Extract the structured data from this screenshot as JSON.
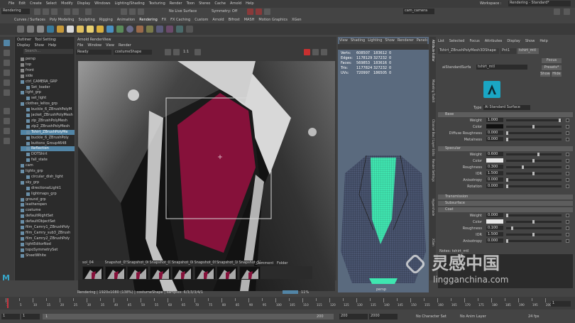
{
  "menubar": {
    "items": [
      "File",
      "Edit",
      "Create",
      "Select",
      "Modify",
      "Display",
      "Windows",
      "Lighting/Shading",
      "Texturing",
      "Render",
      "Toon",
      "Stereo",
      "Cache",
      "Arnold",
      "Help"
    ],
    "mode": "Rendering",
    "no_live": "No Live Surface",
    "symmetry": "Symmetry: Off",
    "camera": "cam_camera",
    "workspace_label": "Workspace :",
    "workspace": "Rendering - Standard*"
  },
  "shelf": {
    "tabs": [
      "Curves / Surfaces",
      "Poly Modeling",
      "Sculpting",
      "Rigging",
      "Animation",
      "Rendering",
      "FX",
      "FX Caching",
      "Custom",
      "Arnold",
      "Bifrost",
      "MASH",
      "Motion Graphics",
      "XGen"
    ]
  },
  "outliner": {
    "tabs": [
      "Outliner",
      "Tool Settings"
    ],
    "menu": [
      "Display",
      "Show",
      "Help"
    ],
    "search": "Search...",
    "rows": [
      "persp",
      "top",
      "front",
      "side",
      "ctrl_CAMERA_GRP",
      "Set_loader",
      "light_grp",
      "set_light",
      "clothes_leltos_grp",
      "buckle_6_ZBrushPolyM",
      "jacket_ZBrushPolyMesh",
      "zip_ZBrushPolyMesh",
      "zip2_ZBrushPolyMesh",
      "Tshirt_ZBrushPolyMe",
      "buckle_6_ZBrushPoly",
      "buttons_Group4648",
      "Reflection",
      "DOTShirt",
      "fall_state",
      "cam",
      "lights_grp",
      "circular_dish_light",
      "sky_grp",
      "directionalLight1",
      "lightmaps_grp",
      "ground_grp",
      "leatheropen",
      "costume",
      "defaultRightSet",
      "defaultObjectSet",
      "film_Camry1_ZBrushPoly",
      "film_Camry_sub3_ZBrush",
      "film_Camry2_ZBrushPoly",
      "lightEditorNod",
      "topoSymmetrySet",
      "SheetWhite"
    ]
  },
  "renderview": {
    "title": "Arnold RenderView",
    "menu": [
      "File",
      "Window",
      "View",
      "Render"
    ],
    "status": "Ready",
    "camera": "costumeShape",
    "ratio": "1:1",
    "snapshots": [
      "sol_04",
      "Snapshot_05",
      "Snapshot_06",
      "Snapshot_07",
      "Snapshot_08",
      "Snapshot_09",
      "Snapshot_10",
      "Snapshot_11"
    ],
    "comment": "Comment",
    "folder": "Folder",
    "status_bar": "Rendering | 1920x1080 (138%) | costumeShape | samples: 6/3/3/3/4/1",
    "zoom": "11%"
  },
  "viewport": {
    "menu": [
      "View",
      "Shading",
      "Lighting",
      "Show",
      "Renderer",
      "Panels"
    ],
    "stats": [
      [
        "Verts:",
        "608507",
        "183612",
        "0"
      ],
      [
        "Edges:",
        "1178129",
        "327232",
        "0"
      ],
      [
        "Faces:",
        "569853",
        "183616",
        "0"
      ],
      [
        "Tris:",
        "1177824",
        "327232",
        "0"
      ],
      [
        "UVs:",
        "720997",
        "186505",
        "0"
      ]
    ],
    "camera_label": "persp"
  },
  "side_tabs": [
    "Attribute Editor",
    "Modeling Toolkit",
    "Channel Box / Layer Editor",
    "Render Settings",
    "Hypershade",
    "XGen"
  ],
  "attr": {
    "menu": [
      "List",
      "Selected",
      "Focus",
      "Attributes",
      "Display",
      "Show",
      "Help"
    ],
    "tabs": [
      "Tshirt_ZBrushPolyMesh3DShape",
      "Pnt1",
      "tshirt_mtl"
    ],
    "node_label": "aiStandardSurface:",
    "node_value": "tshirt_mtl",
    "buttons": [
      "Focus",
      "Presets*",
      "Show",
      "Hide"
    ],
    "type_label": "Type",
    "type_value": "Ai Standard Surface",
    "sections": {
      "base": "Base",
      "specular": "Specular",
      "transmission": "Transmission",
      "subsurface": "Subsurface",
      "coat": "Coat"
    },
    "base": [
      [
        "Weight",
        "1.000"
      ],
      [
        "Color",
        ""
      ],
      [
        "Diffuse Roughness",
        "0.000"
      ],
      [
        "Metalness",
        "0.000"
      ]
    ],
    "specular": [
      [
        "Weight",
        "0.600"
      ],
      [
        "Color",
        ""
      ],
      [
        "Roughness",
        "0.300"
      ],
      [
        "IOR",
        "1.500"
      ],
      [
        "Anisotropy",
        "0.000"
      ],
      [
        "Rotation",
        "0.000"
      ]
    ],
    "coat": [
      [
        "Weight",
        "0.000"
      ],
      [
        "Color",
        ""
      ],
      [
        "Roughness",
        "0.100"
      ],
      [
        "IOR",
        "1.500"
      ],
      [
        "Anisotropy",
        "0.000"
      ]
    ],
    "notes": "Notes: tshirt_mtl"
  },
  "timeline": {
    "ticks": [
      "1",
      "5",
      "10",
      "15",
      "20",
      "25",
      "30",
      "35",
      "40",
      "45",
      "50",
      "55",
      "60",
      "65",
      "70",
      "75",
      "80",
      "85",
      "90",
      "95",
      "100",
      "105",
      "110",
      "115",
      "120",
      "125",
      "130",
      "135",
      "140",
      "145",
      "150",
      "155",
      "160",
      "165",
      "170",
      "175",
      "180",
      "185",
      "190",
      "195",
      "200"
    ],
    "current": "1",
    "range": [
      "1",
      "1",
      "1",
      "200",
      "200",
      "2000"
    ],
    "char": "No Character Set",
    "anim": "No Anim Layer",
    "fps": "24 fps"
  },
  "watermark": {
    "cn": "灵感中国",
    "url": "lingganchina.com"
  },
  "colors": {
    "accent": "#5285a6",
    "tshirt": "#86113a",
    "jacket": "#3d3d3d",
    "mesh_green": "#3fe6b0"
  }
}
